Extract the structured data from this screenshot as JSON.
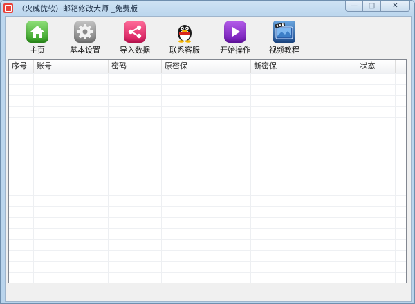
{
  "window": {
    "title": "（火威优软）邮箱修改大师 _免费版",
    "controls": [
      "—",
      "□",
      "✕"
    ]
  },
  "toolbar": {
    "items": [
      {
        "label": "主页",
        "icon": "home-icon"
      },
      {
        "label": "基本设置",
        "icon": "gear-icon"
      },
      {
        "label": "导入数据",
        "icon": "share-icon"
      },
      {
        "label": "联系客服",
        "icon": "qq-penguin-icon"
      },
      {
        "label": "开始操作",
        "icon": "play-icon"
      },
      {
        "label": "视频教程",
        "icon": "video-tutorial-icon"
      }
    ]
  },
  "table": {
    "columns": [
      "序号",
      "账号",
      "密码",
      "原密保",
      "新密保",
      "状态"
    ],
    "rows": []
  },
  "colors": {
    "title_bar": "#bdd7ee",
    "client_bg": "#f0f0f0",
    "grid_line": "#eef0f3"
  }
}
